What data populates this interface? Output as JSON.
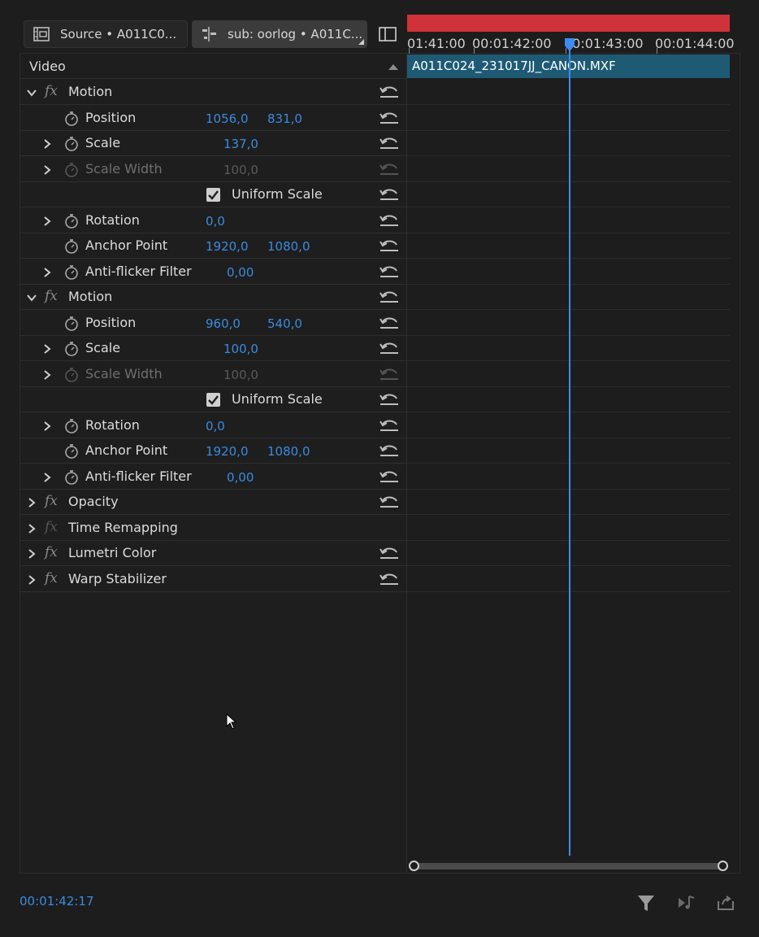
{
  "tabs": {
    "source_label": "Source • A011C0...",
    "sub_label": "sub: oorlog • A011C..."
  },
  "panel": {
    "video_header": "Video"
  },
  "rows": [
    {
      "type": "effect",
      "label": "Motion",
      "expanded": true,
      "reset": true
    },
    {
      "type": "param",
      "label": "Position",
      "expandable": false,
      "v1": "1056,0",
      "v2": "831,0",
      "reset": true
    },
    {
      "type": "param",
      "label": "Scale",
      "expandable": true,
      "v1": "137,0",
      "v1pos": "mid",
      "reset": true
    },
    {
      "type": "param",
      "label": "Scale Width",
      "expandable": true,
      "v1": "100,0",
      "v1pos": "mid",
      "disabled": true,
      "reset": true
    },
    {
      "type": "check",
      "label": "Uniform Scale",
      "checked": true,
      "reset": true
    },
    {
      "type": "param",
      "label": "Rotation",
      "expandable": true,
      "v1": "0,0",
      "reset": true
    },
    {
      "type": "param",
      "label": "Anchor Point",
      "expandable": false,
      "v1": "1920,0",
      "v2": "1080,0",
      "reset": true
    },
    {
      "type": "param",
      "label": "Anti-flicker Filter",
      "expandable": true,
      "v1": "0,00",
      "v1pos": "mid2",
      "reset": true
    },
    {
      "type": "effect",
      "label": "Motion",
      "expanded": true,
      "reset": true
    },
    {
      "type": "param",
      "label": "Position",
      "expandable": false,
      "v1": "960,0",
      "v2": "540,0",
      "reset": true
    },
    {
      "type": "param",
      "label": "Scale",
      "expandable": true,
      "v1": "100,0",
      "v1pos": "mid",
      "reset": true
    },
    {
      "type": "param",
      "label": "Scale Width",
      "expandable": true,
      "v1": "100,0",
      "v1pos": "mid",
      "disabled": true,
      "reset": true
    },
    {
      "type": "check",
      "label": "Uniform Scale",
      "checked": true,
      "reset": true
    },
    {
      "type": "param",
      "label": "Rotation",
      "expandable": true,
      "v1": "0,0",
      "reset": true
    },
    {
      "type": "param",
      "label": "Anchor Point",
      "expandable": false,
      "v1": "1920,0",
      "v2": "1080,0",
      "reset": true
    },
    {
      "type": "param",
      "label": "Anti-flicker Filter",
      "expandable": true,
      "v1": "0,00",
      "v1pos": "mid2",
      "reset": true
    },
    {
      "type": "effect",
      "label": "Opacity",
      "expanded": false,
      "reset": true
    },
    {
      "type": "effect",
      "label": "Time Remapping",
      "expanded": false,
      "reset": false,
      "fxdim": true
    },
    {
      "type": "effect",
      "label": "Lumetri Color",
      "expanded": false,
      "reset": true
    },
    {
      "type": "effect",
      "label": "Warp Stabilizer",
      "expanded": false,
      "reset": true
    }
  ],
  "timeline": {
    "ticks": [
      "01:41:00",
      "00:01:42:00",
      "00:01:43:00",
      "00:01:44:00"
    ],
    "clip_name": "A011C024_231017JJ_CANON.MXF"
  },
  "footer": {
    "timecode": "00:01:42:17"
  },
  "colors": {
    "accent_blue": "#3a8be0",
    "clip_bg": "#1f5a74",
    "work_area_red": "#d0323a"
  }
}
